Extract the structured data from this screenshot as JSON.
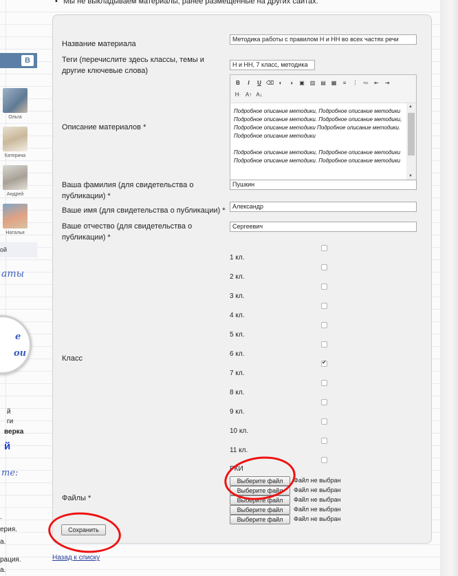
{
  "notice": "Мы не выкладываем материалы, ранее размещенные на других сайтах.",
  "left": {
    "vk_logo": "В",
    "people": [
      "Ольга",
      "Катерина",
      "Андрей",
      "Наталья"
    ],
    "selected_item": "ой",
    "script_1": "аты",
    "seal_1": "е",
    "seal_2": "ои",
    "texts": [
      "й",
      "ги",
      "верка"
    ],
    "big_text": "й",
    "script_2": "те:",
    "texts_2": [
      ".",
      "ерия.",
      "а."
    ],
    "texts_3": [
      "рация.",
      "а."
    ]
  },
  "form": {
    "title_label": "Название материала",
    "title_value": "Методика работы с правилом Н и НН во всех частях речи",
    "tags_label": "Теги (перечислите здесь классы, темы и другие ключевые слова)",
    "tags_value": "Н и НН, 7 класс, методика",
    "description_label": "Описание материалов *",
    "description_paragraphs": [
      "Подробное описание методики, Подробное описание методики Подробное описание методики. Подробное описание методики, Подробное описание методики Подробное описание методики. Подробное описание методики",
      "Подробное описание методики, Подробное описание методики Подробное описание методики. Подробное описание методики"
    ],
    "toolbar_icons": [
      "bold-icon",
      "italic-icon",
      "underline-icon",
      "eraser-icon",
      "link-icon",
      "unlink-icon",
      "image-icon",
      "table-icon",
      "paste-icon",
      "paste-text-icon",
      "align-icon",
      "ordered-list-icon",
      "unordered-list-icon",
      "outdent-icon",
      "indent-icon",
      "heading-icon",
      "font-size-up-icon",
      "font-size-down-icon"
    ],
    "toolbar_glyphs": [
      "B",
      "I",
      "U",
      "⌫",
      "◐",
      "◑",
      "▣",
      "▥",
      "▤",
      "▦",
      "≡",
      "⋮",
      "≔",
      "⇤",
      "⇥",
      "H·",
      "A↑",
      "A↓"
    ],
    "surname_label": "Ваша фамилия (для свидетельства о публикации) *",
    "surname_value": "Пушкин",
    "name_label": "Ваше имя (для свидетельства о публикации) *",
    "name_value": "Александр",
    "patronymic_label": "Ваше отчество (для свидетельства о публикации) *",
    "patronymic_value": "Сергеевич",
    "class_label": "Класс",
    "classes": [
      {
        "label": "1 кл.",
        "checked": false
      },
      {
        "label": "2 кл.",
        "checked": false
      },
      {
        "label": "3 кл.",
        "checked": false
      },
      {
        "label": "4 кл.",
        "checked": false
      },
      {
        "label": "5 кл.",
        "checked": false
      },
      {
        "label": "6 кл.",
        "checked": false
      },
      {
        "label": "7 кл.",
        "checked": true
      },
      {
        "label": "8 кл.",
        "checked": false
      },
      {
        "label": "9 кл.",
        "checked": false
      },
      {
        "label": "10 кл.",
        "checked": false
      },
      {
        "label": "11 кл.",
        "checked": false
      },
      {
        "label": "РКИ",
        "checked": false
      }
    ],
    "files_label": "Файлы *",
    "file_button": "Выберите файл",
    "file_status": "Файл не выбран",
    "save_button": "Сохранить"
  },
  "back_link": "Назад к списку",
  "colors": {
    "vk_blue": "#5b7fa6",
    "annotation_red": "#e11111",
    "link": "#2a3f9a"
  }
}
